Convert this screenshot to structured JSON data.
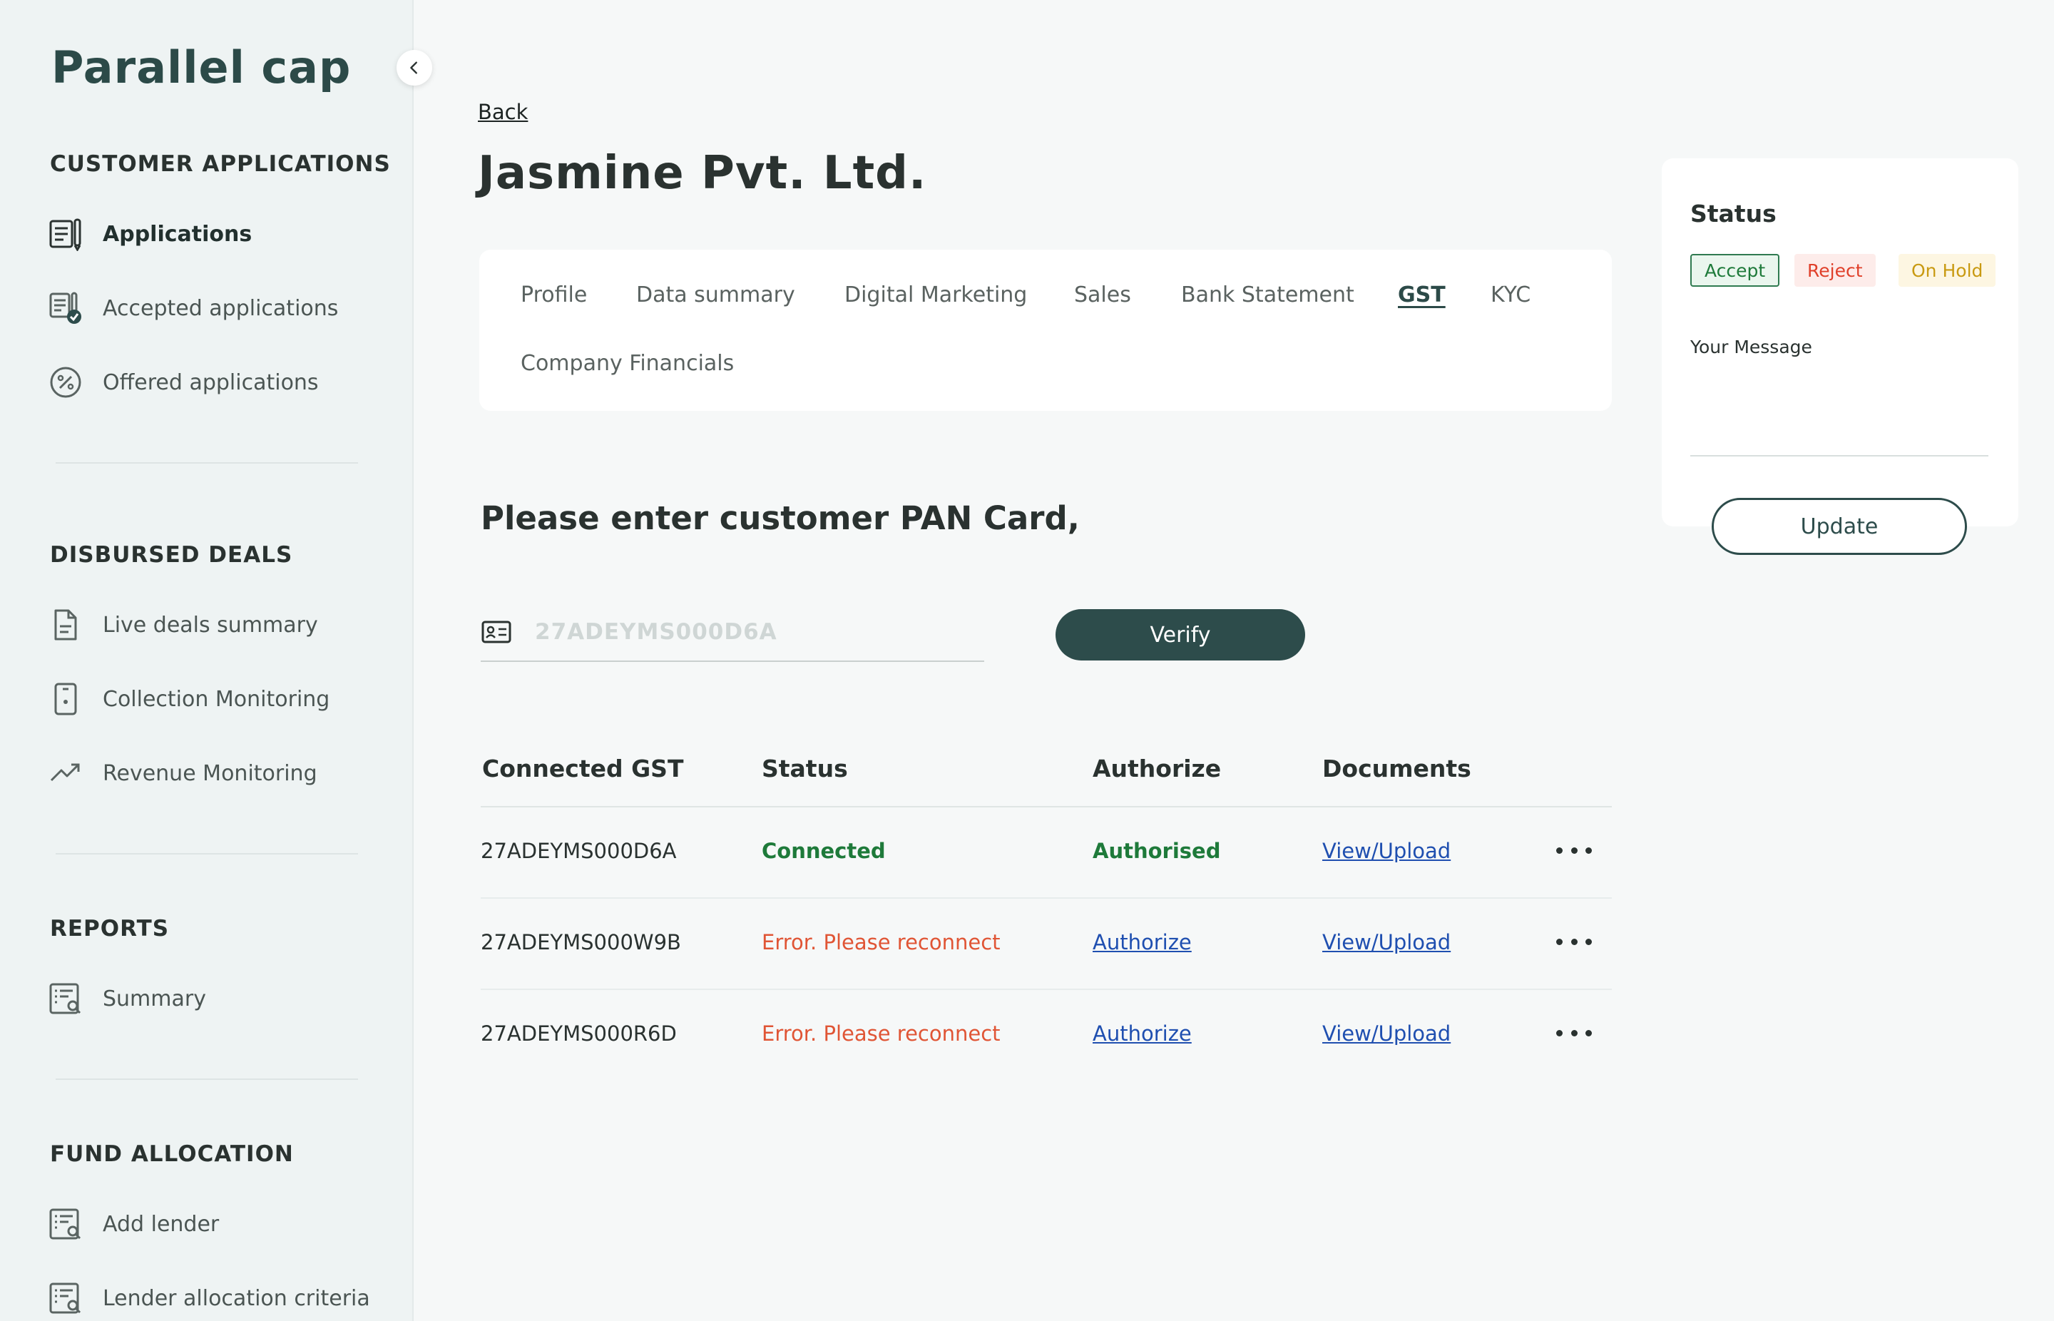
{
  "brand": "Parallel cap",
  "sidebar": {
    "sections": [
      {
        "title": "CUSTOMER APPLICATIONS",
        "items": [
          {
            "label": "Applications",
            "icon": "applications-icon",
            "active": true
          },
          {
            "label": "Accepted applications",
            "icon": "accepted-applications-icon"
          },
          {
            "label": "Offered applications",
            "icon": "percent-badge-icon"
          }
        ]
      },
      {
        "title": "DISBURSED DEALS",
        "items": [
          {
            "label": "Live deals summary",
            "icon": "document-icon"
          },
          {
            "label": "Collection Monitoring",
            "icon": "phone-device-icon"
          },
          {
            "label": "Revenue Monitoring",
            "icon": "trending-up-icon"
          }
        ]
      },
      {
        "title": "REPORTS",
        "items": [
          {
            "label": "Summary",
            "icon": "report-search-icon"
          }
        ]
      },
      {
        "title": "FUND ALLOCATION",
        "items": [
          {
            "label": "Add lender",
            "icon": "report-search-icon"
          },
          {
            "label": "Lender allocation criteria",
            "icon": "report-search-icon"
          }
        ]
      }
    ]
  },
  "main": {
    "back_label": "Back",
    "title": "Jasmine Pvt. Ltd.",
    "tabs": [
      {
        "label": "Profile"
      },
      {
        "label": "Data summary"
      },
      {
        "label": "Digital Marketing"
      },
      {
        "label": "Sales"
      },
      {
        "label": "Bank Statement"
      },
      {
        "label": "GST",
        "active": true
      },
      {
        "label": "KYC"
      },
      {
        "label": "Company Financials"
      }
    ],
    "pan_heading": "Please enter customer PAN Card,",
    "pan_placeholder": "27ADEYMS000D6A",
    "verify_label": "Verify",
    "table": {
      "headers": [
        "Connected GST",
        "Status",
        "Authorize",
        "Documents"
      ],
      "rows": [
        {
          "gst": "27ADEYMS000D6A",
          "status": "Connected",
          "status_type": "ok",
          "authorize": "Authorised",
          "authorize_type": "done",
          "documents": "View/Upload"
        },
        {
          "gst": "27ADEYMS000W9B",
          "status": "Error. Please reconnect",
          "status_type": "error",
          "authorize": "Authorize",
          "authorize_type": "link",
          "documents": "View/Upload"
        },
        {
          "gst": "27ADEYMS000R6D",
          "status": "Error. Please reconnect",
          "status_type": "error",
          "authorize": "Authorize",
          "authorize_type": "link",
          "documents": "View/Upload"
        }
      ]
    }
  },
  "status_panel": {
    "title": "Status",
    "accept_label": "Accept",
    "reject_label": "Reject",
    "hold_label": "On Hold",
    "message_label": "Your Message",
    "update_label": "Update"
  },
  "colors": {
    "brand": "#2c4a48",
    "primary_button": "#2d4c4b",
    "success": "#1e7a3a",
    "error": "#e05535",
    "link": "#1f4fb0",
    "hold": "#c99a12"
  }
}
